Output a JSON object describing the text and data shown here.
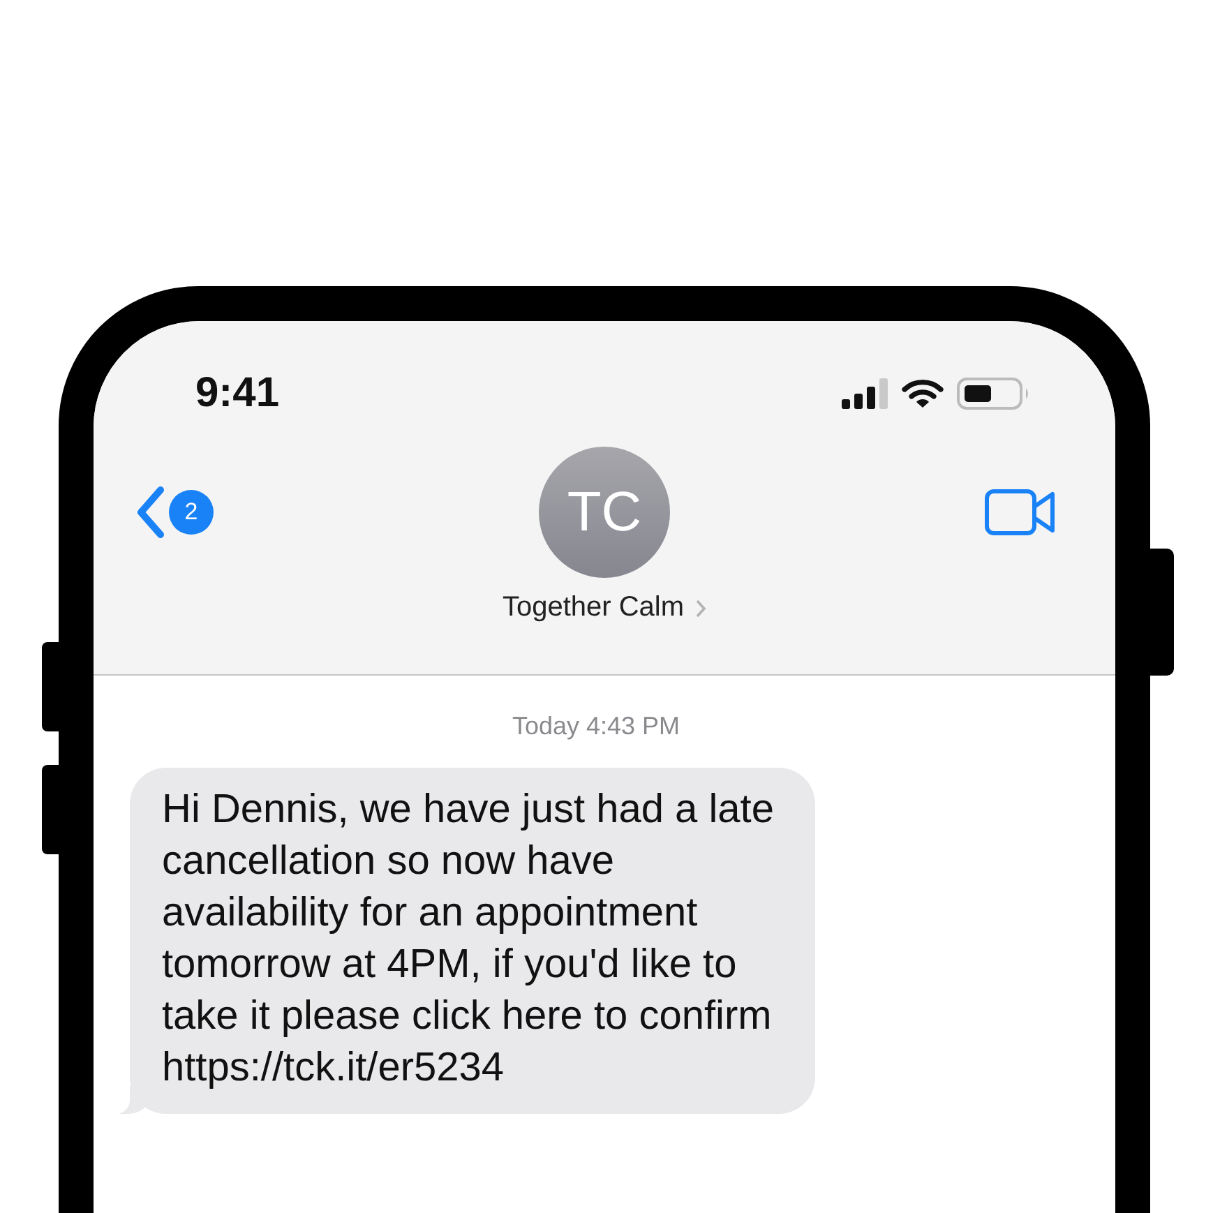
{
  "status_bar": {
    "time": "9:41"
  },
  "header": {
    "back_badge": "2",
    "avatar_initials": "TC",
    "contact_name": "Together Calm"
  },
  "messages": [
    {
      "kind": "timestamp",
      "text": "Today 4:43 PM"
    },
    {
      "kind": "incoming",
      "text": "Hi Dennis, we have just had a late cancellation so now have availability for an appointment tomorrow at 4PM, if you'd like to take it please click here to confirm https://tck.it/er5234"
    }
  ]
}
